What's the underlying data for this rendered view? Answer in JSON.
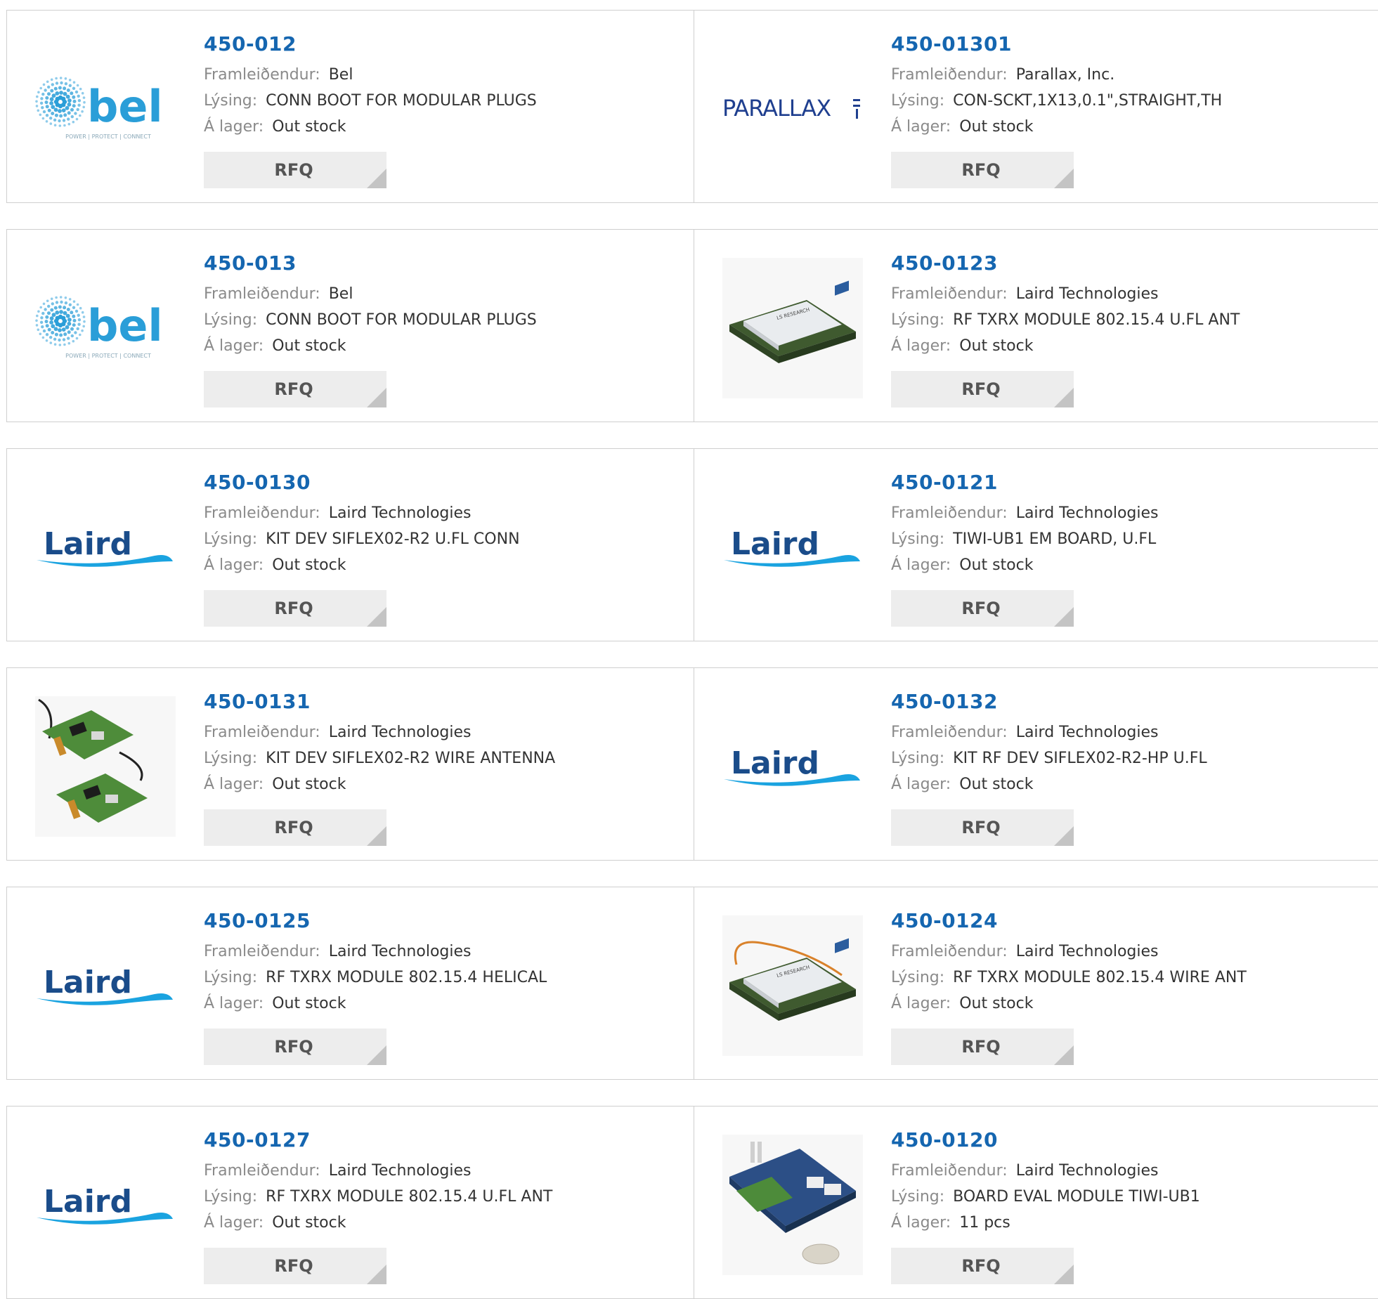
{
  "labels": {
    "manufacturer": "Framleiðendur:",
    "description": "Lýsing:",
    "stock": "Á lager:",
    "rfq": "RFQ"
  },
  "logos": {
    "bel": {
      "word": "bel",
      "tagline": "POWER | PROTECT | CONNECT",
      "color": "#2a9ed8"
    },
    "parallax": {
      "word": "PARALLAX",
      "color": "#1f3f8f"
    },
    "laird": {
      "word": "Laird",
      "color": "#1a4c8a",
      "swoosh": "#1aa3e0"
    },
    "lsr": {
      "word": "LS RESEARCH"
    }
  },
  "products": [
    {
      "part": "450-012",
      "manufacturer": "Bel",
      "description": "CONN BOOT FOR MODULAR PLUGS",
      "stock": "Out stock",
      "image": "bel-logo"
    },
    {
      "part": "450-01301",
      "manufacturer": "Parallax, Inc.",
      "description": "CON-SCKT,1X13,0.1\",STRAIGHT,TH",
      "stock": "Out stock",
      "image": "parallax-logo"
    },
    {
      "part": "450-013",
      "manufacturer": "Bel",
      "description": "CONN BOOT FOR MODULAR PLUGS",
      "stock": "Out stock",
      "image": "bel-logo"
    },
    {
      "part": "450-0123",
      "manufacturer": "Laird Technologies",
      "description": "RF TXRX MODULE 802.15.4 U.FL ANT",
      "stock": "Out stock",
      "image": "rf-module-photo"
    },
    {
      "part": "450-0130",
      "manufacturer": "Laird Technologies",
      "description": "KIT DEV SIFLEX02-R2 U.FL CONN",
      "stock": "Out stock",
      "image": "laird-logo"
    },
    {
      "part": "450-0121",
      "manufacturer": "Laird Technologies",
      "description": "TIWI-UB1 EM BOARD, U.FL",
      "stock": "Out stock",
      "image": "laird-logo"
    },
    {
      "part": "450-0131",
      "manufacturer": "Laird Technologies",
      "description": "KIT DEV SIFLEX02-R2 WIRE ANTENNA",
      "stock": "Out stock",
      "image": "dev-kit-photo"
    },
    {
      "part": "450-0132",
      "manufacturer": "Laird Technologies",
      "description": "KIT RF DEV SIFLEX02-R2-HP U.FL",
      "stock": "Out stock",
      "image": "laird-logo"
    },
    {
      "part": "450-0125",
      "manufacturer": "Laird Technologies",
      "description": "RF TXRX MODULE 802.15.4 HELICAL",
      "stock": "Out stock",
      "image": "laird-logo"
    },
    {
      "part": "450-0124",
      "manufacturer": "Laird Technologies",
      "description": "RF TXRX MODULE 802.15.4 WIRE ANT",
      "stock": "Out stock",
      "image": "rf-module-wire-photo"
    },
    {
      "part": "450-0127",
      "manufacturer": "Laird Technologies",
      "description": "RF TXRX MODULE 802.15.4 U.FL ANT",
      "stock": "Out stock",
      "image": "laird-logo"
    },
    {
      "part": "450-0120",
      "manufacturer": "Laird Technologies",
      "description": "BOARD EVAL MODULE TIWI-UB1",
      "stock": "11 pcs",
      "image": "eval-board-photo"
    }
  ]
}
